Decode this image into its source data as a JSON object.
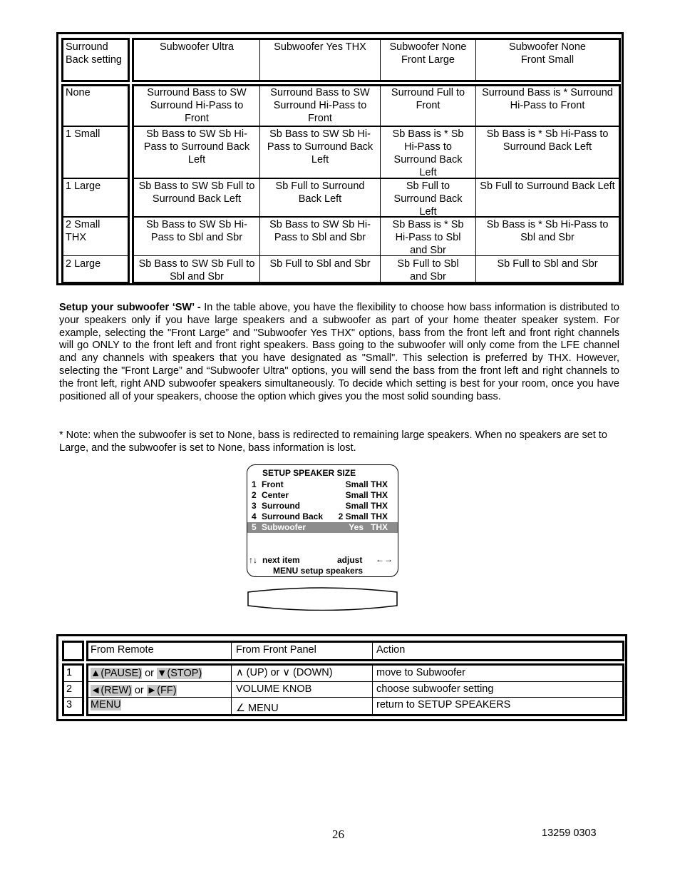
{
  "bass_table": {
    "header": {
      "row_label": "Surround Back setting",
      "columns": [
        "Subwoofer Ultra",
        "Subwoofer Yes THX",
        "Subwoofer None Front Large",
        "Subwoofer None Front Small"
      ]
    },
    "rows": [
      {
        "label": "None",
        "cells": [
          "Surround Bass to SW Surround Hi-Pass to Front",
          "Surround Bass to SW Surround Hi-Pass to Front",
          "Surround Full to Front",
          "Surround Bass is * Surround Hi-Pass to Front"
        ]
      },
      {
        "label": "1 Small",
        "cells": [
          "Sb Bass to SW Sb Hi-Pass to Surround Back Left",
          "Sb Bass to SW Sb Hi-Pass to Surround Back Left",
          "Sb Bass is * Sb Hi-Pass to Surround Back Left",
          "Sb Bass is * Sb Hi-Pass to Surround Back Left"
        ]
      },
      {
        "label": "1 Large",
        "cells": [
          "Sb Bass to SW Sb Full to Surround Back Left",
          "Sb Full to Surround Back Left",
          "Sb Full to Surround Back Left",
          "Sb Full to Surround Back Left"
        ]
      },
      {
        "label": "2 Small THX",
        "cells": [
          "Sb Bass to SW Sb Hi-Pass to Sbl and Sbr",
          "Sb Bass to SW Sb Hi-Pass to Sbl and Sbr",
          "Sb Bass is * Sb Hi-Pass to Sbl and Sbr",
          "Sb Bass is * Sb Hi-Pass to Sbl and Sbr"
        ]
      },
      {
        "label": "2 Large",
        "cells": [
          "Sb Bass to SW Sb Full to Sbl and Sbr",
          "Sb Full to Sbl and Sbr",
          "Sb Full to Sbl and Sbr",
          "Sb Full to Sbl and Sbr"
        ]
      }
    ]
  },
  "setup_paragraph": {
    "heading": "Setup your subwoofer ‘SW’ -",
    "text": " In the table above, you have the flexibility to choose how bass information is distributed to your speakers only if you have large speakers and a subwoofer as part of your home theater speaker system. For example, selecting the \"Front Large” and \"Subwoofer Yes THX\" options, bass from the front left and front right channels will go ONLY to the front left and front right speakers.  Bass going to the subwoofer will only come from the LFE channel and any channels with speakers that you have designated as \"Small\". This selection is preferred by THX. However, selecting the \"Front Large” and “Subwoofer Ultra\" options, you will send the bass from the front left and right channels to the front left, right AND subwoofer speakers simultaneously. To decide which setting is best for your room, once you have positioned all of your speakers, choose the option which gives you the most solid sounding bass."
  },
  "note": "* Note: when the subwoofer is set to None, bass is redirected to remaining large speakers. When no speakers are set to Large, and the subwoofer is set to None, bass information is lost.",
  "lcd": {
    "title": "SETUP SPEAKER SIZE",
    "items": [
      {
        "num": "1",
        "label": "Front",
        "value": "Small THX"
      },
      {
        "num": "2",
        "label": "Center",
        "value": "Small THX"
      },
      {
        "num": "3",
        "label": "Surround",
        "value": "Small THX"
      },
      {
        "num": "4",
        "label": "Surround Back",
        "value": "2 Small THX"
      },
      {
        "num": "5",
        "label": "Subwoofer",
        "value": "Yes   THX"
      }
    ],
    "selected_index": 4,
    "nav_hint": "next item",
    "adjust_hint": "adjust",
    "menu_hint": "MENU setup speakers",
    "icons": {
      "updown": "↑↓",
      "leftright": "←→"
    }
  },
  "action_table": {
    "headers": [
      "From Remote",
      "From Front Panel",
      "Action"
    ],
    "rows": [
      {
        "num": "1",
        "remote_a": "▲(PAUSE)",
        "remote_or": " or ",
        "remote_b": "▼(STOP)",
        "panel": "∧ (UP) or ∨ (DOWN)",
        "action": "move to Subwoofer"
      },
      {
        "num": "2",
        "remote_a": "◄(REW)",
        "remote_or": " or ",
        "remote_b": "►(FF)",
        "panel": "VOLUME KNOB",
        "action": "choose subwoofer setting"
      },
      {
        "num": "3",
        "remote_a": "MENU",
        "remote_or": "",
        "remote_b": "",
        "panel": "∠ MENU",
        "action": "return to SETUP SPEAKERS"
      }
    ]
  },
  "footer": {
    "page_number": "26",
    "doc_code": "13259 0303"
  }
}
